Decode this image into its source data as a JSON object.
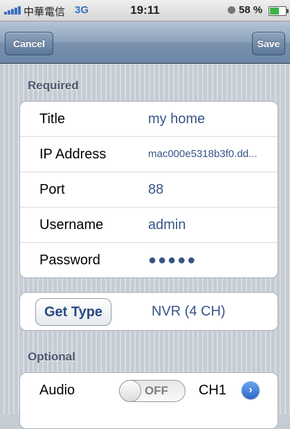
{
  "status_bar": {
    "carrier": "中華電信",
    "network": "3G",
    "time": "19:11",
    "battery": "58 %",
    "battery_level": 0.58
  },
  "nav": {
    "cancel_label": "Cancel",
    "save_label": "Save"
  },
  "required": {
    "header": "Required",
    "fields": [
      {
        "label": "Title",
        "value": "my home"
      },
      {
        "label": "IP Address",
        "value": "mac000e5318b3f0.dd..."
      },
      {
        "label": "Port",
        "value": "88"
      },
      {
        "label": "Username",
        "value": "admin"
      },
      {
        "label": "Password",
        "value": "●●●●●"
      }
    ]
  },
  "type": {
    "button_label": "Get Type",
    "value": "NVR (4 CH)"
  },
  "optional": {
    "header": "Optional",
    "audio": {
      "label": "Audio",
      "toggle": "OFF",
      "channel": "CH1"
    }
  },
  "colors": {
    "value_text": "#385487",
    "nav_bar": "#6d87a6",
    "background": "#c5ccd4"
  }
}
